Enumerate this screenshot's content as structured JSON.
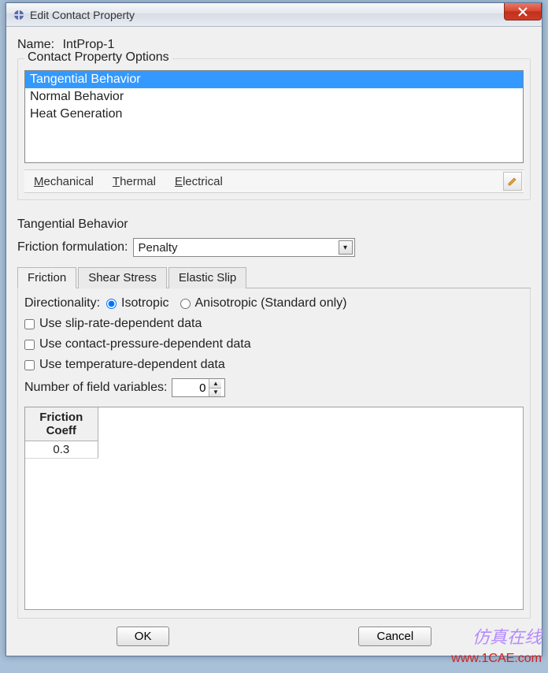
{
  "window": {
    "title": "Edit Contact Property"
  },
  "name": {
    "label": "Name:",
    "value": "IntProp-1"
  },
  "options": {
    "legend": "Contact Property Options",
    "items": [
      "Tangential Behavior",
      "Normal Behavior",
      "Heat Generation"
    ],
    "selected_index": 0
  },
  "menutabs": {
    "mechanical": "Mechanical",
    "thermal": "Thermal",
    "electrical": "Electrical"
  },
  "section": {
    "title": "Tangential Behavior"
  },
  "friction_formulation": {
    "label": "Friction formulation:",
    "value": "Penalty"
  },
  "tabs": {
    "friction": "Friction",
    "shear": "Shear Stress",
    "elastic": "Elastic Slip"
  },
  "directionality": {
    "label": "Directionality:",
    "isotropic": "Isotropic",
    "anisotropic": "Anisotropic (Standard only)",
    "value": "isotropic"
  },
  "checks": {
    "slip_rate": "Use slip-rate-dependent data",
    "contact_pressure": "Use contact-pressure-dependent data",
    "temperature": "Use temperature-dependent data"
  },
  "field_vars": {
    "label": "Number of field variables:",
    "value": "0"
  },
  "table": {
    "header": "Friction Coeff",
    "rows": [
      "0.3"
    ]
  },
  "buttons": {
    "ok": "OK",
    "cancel": "Cancel"
  },
  "watermark": {
    "line1": "仿真在线",
    "line2": "www.1CAE.com"
  }
}
